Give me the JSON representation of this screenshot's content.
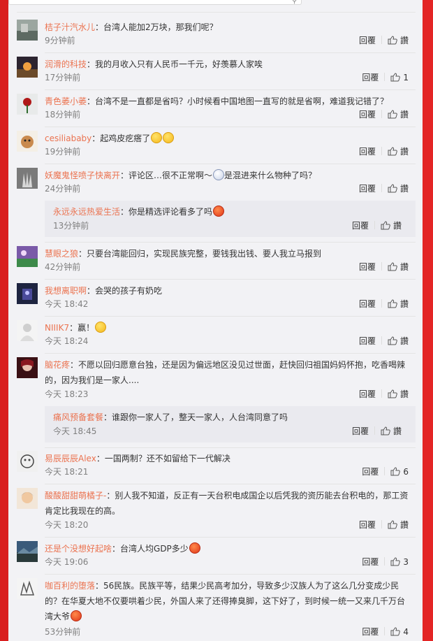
{
  "ui": {
    "reply_label": "回覆",
    "like_label": "讚"
  },
  "comments": [
    {
      "user": "桔子汁汽水儿",
      "text": "：台湾人能加2万块，那我们呢？",
      "time": "9分钟前",
      "likes": "讚"
    },
    {
      "user": "润滑的科技",
      "text": "：我的月收入只有人民币一千元，好羡慕人家唉",
      "time": "17分钟前",
      "likes": "1"
    },
    {
      "user": "青色萎小萎",
      "text": "：台湾不是一直都是省吗？小时候看中国地图一直写的就是省啊，难道我记错了？",
      "time": "18分钟前",
      "likes": "讚"
    },
    {
      "user": "cesiliababy",
      "text": "：起鸡皮疙瘩了",
      "time": "19分钟前",
      "likes": "讚"
    },
    {
      "user": "妖魔鬼怪喷子快离开",
      "text_a": "：评论区…很不正常啊～",
      "text_b": "是混进来什么物种了吗？",
      "time": "24分钟前",
      "likes": "讚"
    },
    {
      "user": "永远永远热爱生活",
      "text": "：你是精选评论看多了吗",
      "time": "13分钟前",
      "likes": "讚"
    },
    {
      "user": "慧眼之狼",
      "text": "：只要台湾能回归，实现民族完整，要钱我出钱、要人我立马报到",
      "time": "42分钟前",
      "likes": "讚"
    },
    {
      "user": "我想离职啊",
      "text": "：会哭的孩子有奶吃",
      "time": "今天 18:42",
      "likes": "讚"
    },
    {
      "user": "NIIIK7",
      "text": "：赢！",
      "time": "今天 18:24",
      "likes": "讚"
    },
    {
      "user": "脑花疼",
      "text_line1": "：不愿以回归愿意台独，还是因为偏远地区没见过世面，赶快回归祖国妈妈怀抱，吃香喝辣",
      "text_line2": "的，因为我们是一家人....",
      "time": "今天 18:23",
      "likes": "讚"
    },
    {
      "user": "痛风预备套餐",
      "text": "：谁跟你一家人了，整天一家人，人台湾同意了吗",
      "time": "今天 18:45",
      "likes": "讚"
    },
    {
      "user": "易辰辰辰Alex",
      "text": "：一国两制？还不如留给下一代解决",
      "time": "今天 18:21",
      "likes": "6"
    },
    {
      "user": "酸酸甜甜萌橘子-",
      "text_line1": "：别人我不知道，反正有一天台积电成国企以后凭我的资历能去台积电的，那工资",
      "text_line2": "肯定比我现在的高。",
      "time": "今天 18:20",
      "likes": "讚"
    },
    {
      "user": "还是个没想好起啥",
      "text": "：台湾人均GDP多少",
      "time": "今天 19:06",
      "likes": "3"
    },
    {
      "user": "咖百利的堕落",
      "text_line1": "：56民族。民族平等，结果少民高考加分，导致多少汉族人为了这么几分变成少民",
      "text_line2": "的？在华夏大地不仅要哄着少民，外国人来了还得捧臭脚，这下好了，到时候一统一又来几千万台",
      "text_line3": "湾大爷",
      "time": "53分钟前",
      "likes": "4"
    }
  ],
  "colors": {
    "username": "#eb7350",
    "side_red": "#e32525",
    "panel_bg": "#f2f2f5"
  }
}
